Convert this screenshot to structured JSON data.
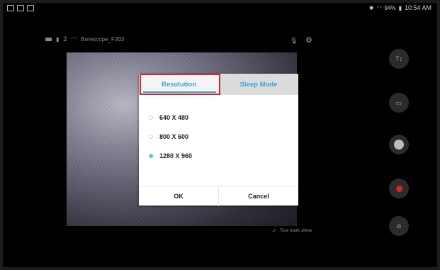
{
  "status_bar": {
    "time": "10:54 AM",
    "battery": "94%"
  },
  "camera_bar": {
    "count": "2",
    "device_name": "Borescope_F303"
  },
  "dialog": {
    "tabs": [
      {
        "label": "Resolution",
        "selected": true
      },
      {
        "label": "Sleep Mode",
        "selected": false
      }
    ],
    "options": [
      {
        "label": "640 X 480",
        "checked": false
      },
      {
        "label": "800 X 600",
        "checked": false
      },
      {
        "label": "1280 X 960",
        "checked": true
      }
    ],
    "ok_label": "OK",
    "cancel_label": "Cancel"
  },
  "text_mark": {
    "label": "Text mark show",
    "checked": true
  },
  "colors": {
    "accent": "#3aa3d6",
    "highlight": "#e0202a",
    "record": "#dd2222"
  },
  "icons": [
    "text-tool-icon",
    "edit-image-icon",
    "shutter-icon",
    "record-icon",
    "settings-icon",
    "mic-icon"
  ]
}
